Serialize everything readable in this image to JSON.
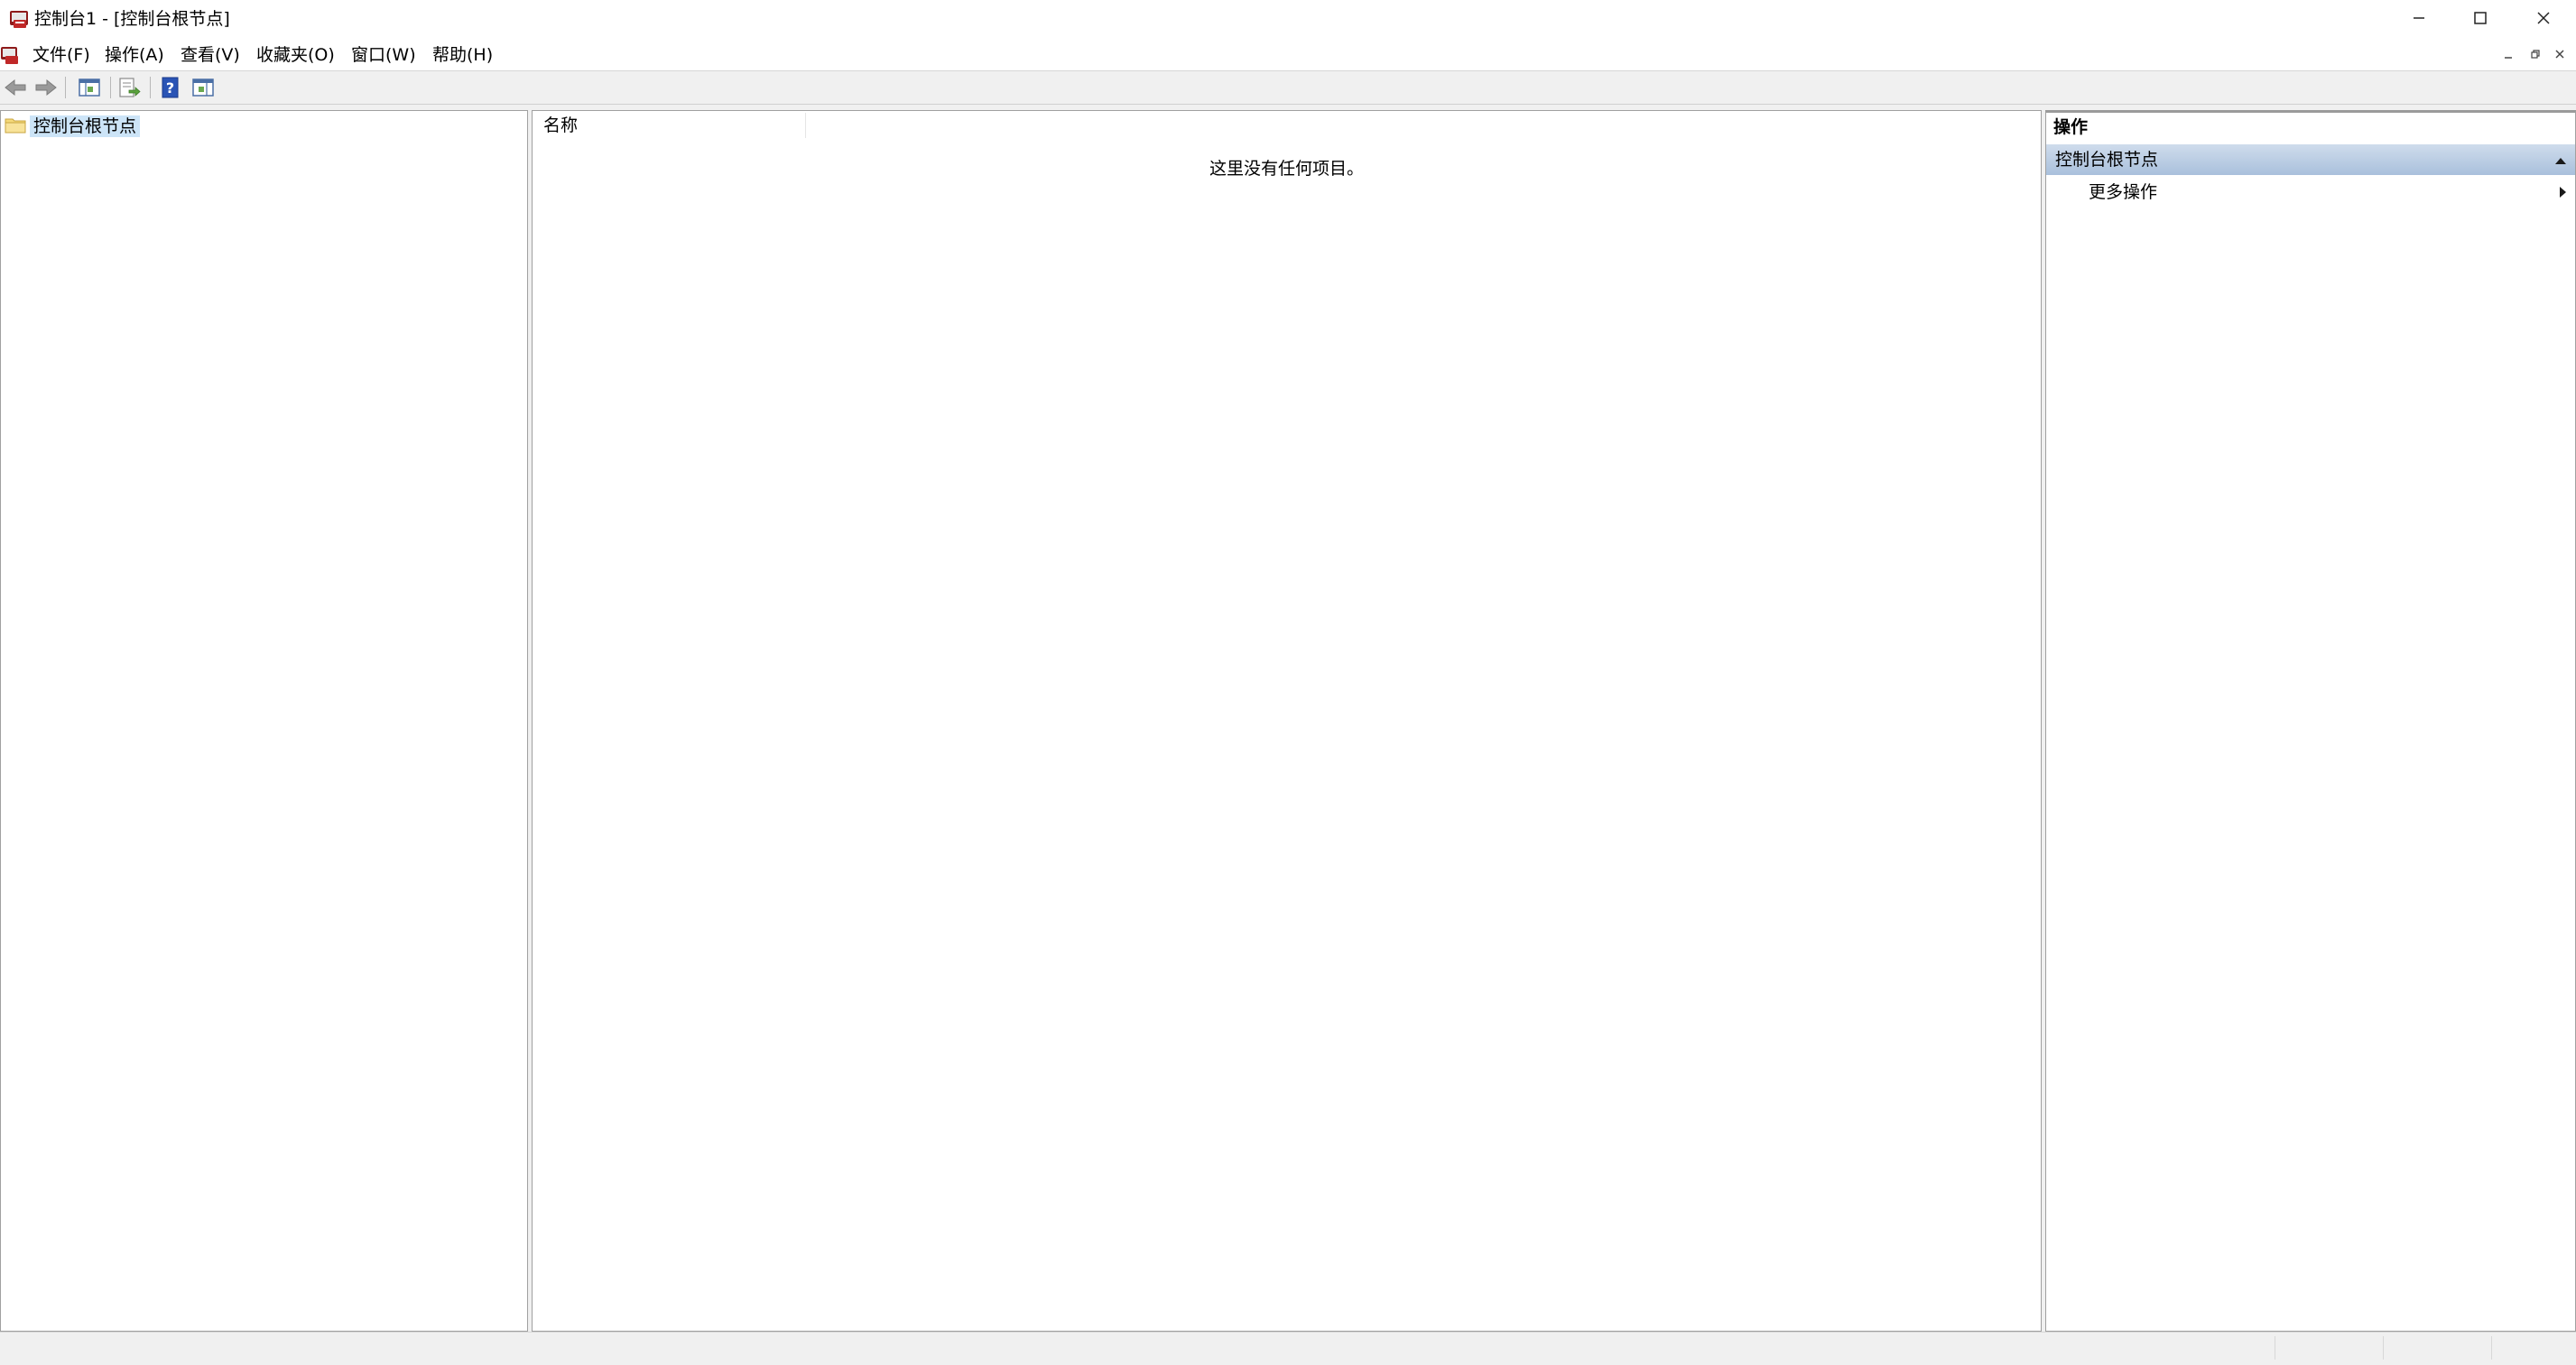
{
  "window": {
    "title": "控制台1 - [控制台根节点]",
    "controls": {
      "minimize": "minimize-icon",
      "maximize": "maximize-icon",
      "close": "close-icon"
    }
  },
  "menubar": {
    "items": [
      {
        "label": "文件(F)"
      },
      {
        "label": "操作(A)"
      },
      {
        "label": "查看(V)"
      },
      {
        "label": "收藏夹(O)"
      },
      {
        "label": "窗口(W)"
      },
      {
        "label": "帮助(H)"
      }
    ]
  },
  "toolbar": {
    "buttons": [
      "back-icon",
      "forward-icon",
      "show-hide-console-tree-icon",
      "export-list-icon",
      "help-icon",
      "show-hide-action-pane-icon"
    ]
  },
  "tree": {
    "root_label": "控制台根节点"
  },
  "list": {
    "column_name": "名称",
    "empty_message": "这里没有任何项目。"
  },
  "actions": {
    "title": "操作",
    "group_label": "控制台根节点",
    "more_actions": "更多操作"
  },
  "colors": {
    "selection": "#cce4f7",
    "group_header_top": "#cfdcec",
    "group_header_bottom": "#a9c0dc"
  }
}
